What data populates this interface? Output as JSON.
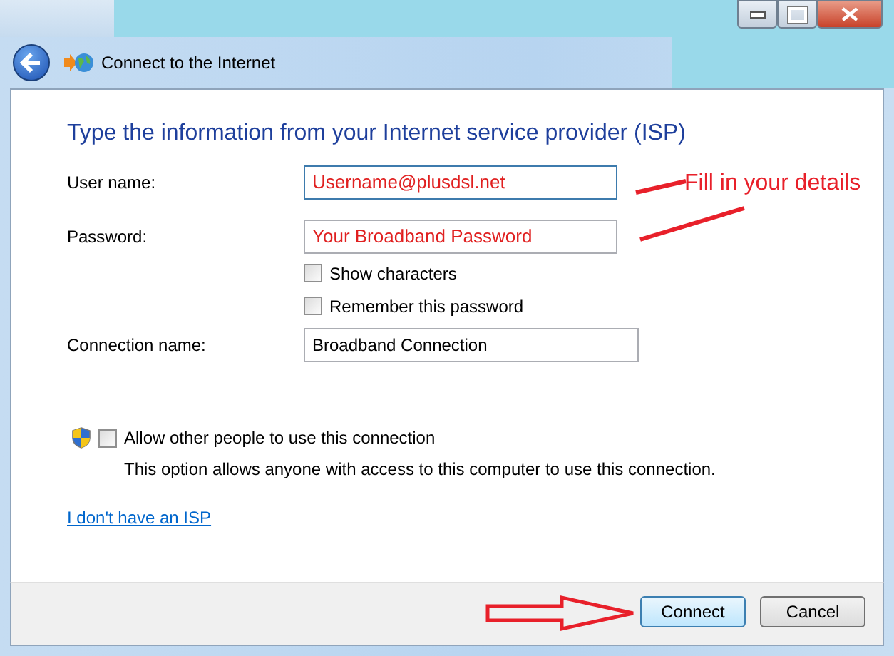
{
  "window": {
    "title": "Connect to the Internet"
  },
  "heading": "Type the information from your Internet service provider (ISP)",
  "fields": [
    {
      "label": "User name:",
      "value": "Username@plusdsl.net",
      "highlighted": true
    },
    {
      "label": "Password:",
      "value": "Your Broadband Password",
      "highlighted": true
    }
  ],
  "checkboxes": [
    {
      "label": "Show characters",
      "checked": false
    },
    {
      "label": "Remember this password",
      "checked": false
    }
  ],
  "connection": {
    "label": "Connection name:",
    "value": "Broadband Connection",
    "highlighted": false
  },
  "share": {
    "label": "Allow other people to use this connection",
    "checked": false,
    "description": "This option allows anyone with access to this computer to use this connection."
  },
  "link": "I don't have an ISP",
  "annotation": "Fill in your details",
  "buttons": [
    {
      "label": "Connect",
      "default": true
    },
    {
      "label": "Cancel",
      "default": false
    }
  ]
}
